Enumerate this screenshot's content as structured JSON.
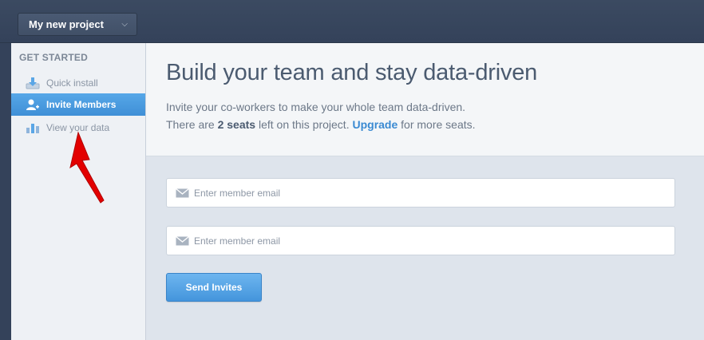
{
  "topbar": {
    "project_name": "My new project",
    "chevron_icon": "chevron-down-icon"
  },
  "sidebar": {
    "heading": "GET STARTED",
    "items": [
      {
        "label": "Quick install",
        "icon": "download-icon",
        "active": false
      },
      {
        "label": "Invite Members",
        "icon": "add-user-icon",
        "active": true
      },
      {
        "label": "View your data",
        "icon": "bar-chart-icon",
        "active": false
      }
    ]
  },
  "main": {
    "title": "Build your team and stay data-driven",
    "line1": "Invite your co-workers to make your whole team data-driven.",
    "line2_prefix": "There are ",
    "seats": "2 seats",
    "line2_middle": " left on this project. ",
    "upgrade_label": "Upgrade",
    "line2_suffix": " for more seats.",
    "email_fields": [
      {
        "placeholder": "Enter member email",
        "value": "",
        "icon": "mail-icon"
      },
      {
        "placeholder": "Enter member email",
        "value": "",
        "icon": "mail-icon"
      }
    ],
    "send_label": "Send Invites"
  },
  "colors": {
    "topbar": "#37465d",
    "accent": "#4495dc",
    "annotation_arrow": "#e00000"
  }
}
